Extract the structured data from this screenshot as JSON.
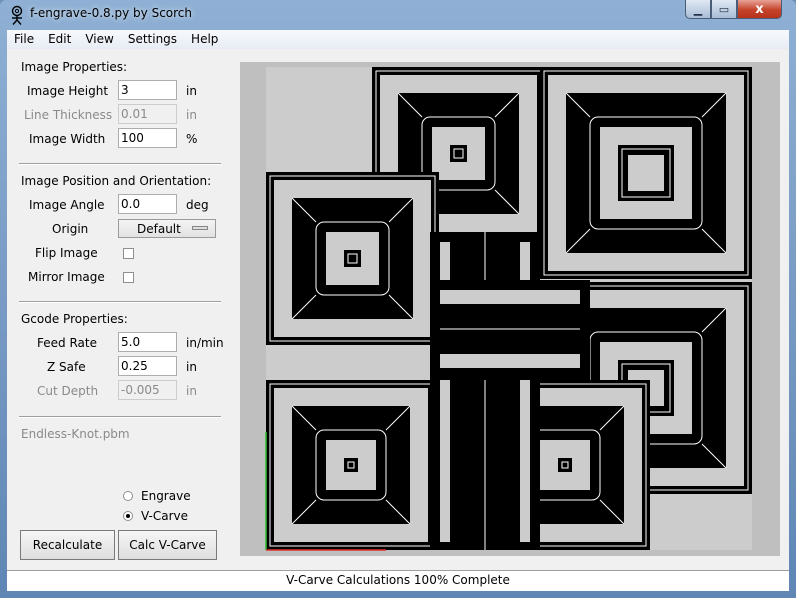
{
  "window": {
    "title": "f-engrave-0.8.py by Scorch",
    "controls": {
      "minimize": "—",
      "maximize": "▫",
      "close": "x"
    }
  },
  "menu": [
    "File",
    "Edit",
    "View",
    "Settings",
    "Help"
  ],
  "image_properties": {
    "heading": "Image Properties:",
    "height": {
      "label": "Image Height",
      "value": "3",
      "unit": "in"
    },
    "line_thickness": {
      "label": "Line Thickness",
      "value": "0.01",
      "unit": "in"
    },
    "width": {
      "label": "Image Width",
      "value": "100",
      "unit": "%"
    }
  },
  "position": {
    "heading": "Image Position and Orientation:",
    "angle": {
      "label": "Image Angle",
      "value": "0.0",
      "unit": "deg"
    },
    "origin": {
      "label": "Origin",
      "value": "Default"
    },
    "flip": {
      "label": "Flip Image",
      "checked": false
    },
    "mirror": {
      "label": "Mirror Image",
      "checked": false
    }
  },
  "gcode": {
    "heading": "Gcode Properties:",
    "feed": {
      "label": "Feed Rate",
      "value": "5.0",
      "unit": "in/min"
    },
    "zsafe": {
      "label": "Z Safe",
      "value": "0.25",
      "unit": "in"
    },
    "depth": {
      "label": "Cut Depth",
      "value": "-0.005",
      "unit": "in"
    }
  },
  "file_name": "Endless-Knot.pbm",
  "mode": {
    "options": [
      "Engrave",
      "V-Carve"
    ],
    "selected": "V-Carve"
  },
  "buttons": {
    "recalculate": "Recalculate",
    "calc_vcarve": "Calc V-Carve"
  },
  "status": "V-Carve Calculations 100% Complete",
  "colors": {
    "canvas_bg": "#bfbfbf",
    "image_bg": "#cccccc",
    "ink": "#000000",
    "toolpath": "#ffffff",
    "x_axis": "#e03030",
    "y_axis": "#30c030"
  }
}
